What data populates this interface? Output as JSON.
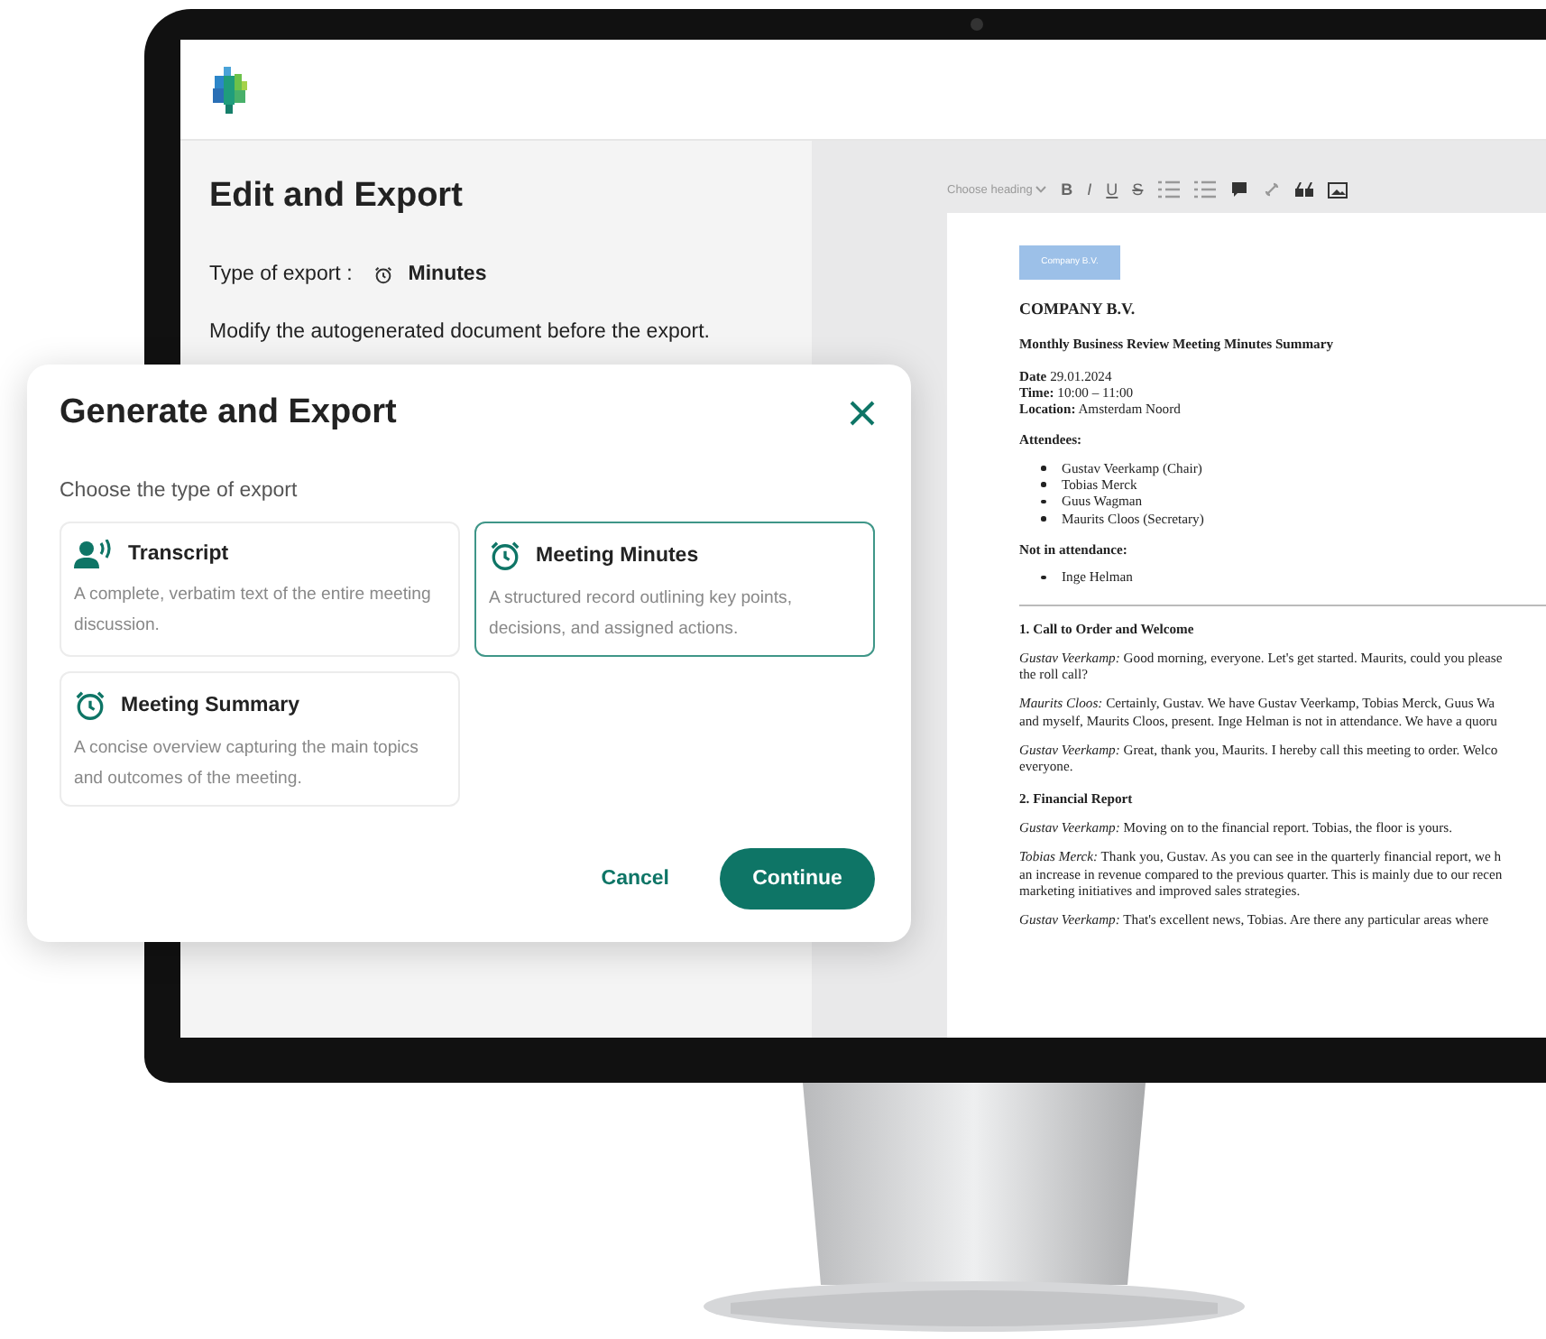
{
  "left_panel": {
    "title": "Edit and Export",
    "export_type_label": "Type of export :",
    "export_type_value": "Minutes",
    "hint": "Modify the autogenerated document before the export."
  },
  "editor": {
    "toolbar": {
      "heading_select": "Choose heading",
      "format_buttons": [
        "B",
        "I",
        "U",
        "S"
      ]
    },
    "document": {
      "logo_text": "Company B.V.",
      "company": "COMPANY B.V.",
      "title": "Monthly Business Review Meeting Minutes Summary",
      "details": [
        "**Date** 29.01.2024",
        "**Time:** 10:00 – 11:00",
        "**Location:** Amsterdam Noord"
      ],
      "attendees_heading": "Attendees:",
      "attendees": [
        "Gustav Veerkamp (Chair)",
        "Tobias Merck",
        "Guus Wagman",
        "Maurits Cloos (Secretary)"
      ],
      "absent_heading": "Not in attendance:",
      "absent": [
        "Inge Helman"
      ],
      "sections": [
        {
          "heading": "1. Call to Order and Welcome",
          "paragraphs": [
            [
              "*Gustav Veerkamp:* Good morning, everyone. Let's get started. Maurits, could you please",
              "the roll call?"
            ],
            [
              "*Maurits Cloos:* Certainly, Gustav. We have Gustav Veerkamp, Tobias Merck, Guus Wa",
              "and myself, Maurits Cloos, present. Inge Helman is not in attendance. We have a quoru"
            ],
            [
              "*Gustav Veerkamp:* Great, thank you, Maurits. I hereby call this meeting to order. Welco",
              "everyone."
            ]
          ]
        },
        {
          "heading": "2. Financial Report",
          "paragraphs": [
            [
              "*Gustav Veerkamp:* Moving on to the financial report. Tobias, the floor is yours."
            ],
            [
              "*Tobias Merck:* Thank you, Gustav. As you can see in the quarterly financial report, we h",
              "an increase in revenue compared to the previous quarter. This is mainly due to our recen",
              "marketing initiatives and improved sales strategies."
            ],
            [
              "*Gustav Veerkamp:* That's excellent news, Tobias. Are there any particular areas where"
            ]
          ]
        }
      ]
    }
  },
  "dialog": {
    "title": "Generate and Export",
    "subtitle": "Choose the type of export",
    "options": [
      {
        "kind": "transcript",
        "title": "Transcript",
        "description": "A complete, verbatim text of the entire meeting discussion.",
        "selected": false
      },
      {
        "kind": "clock",
        "title": "Meeting Minutes",
        "description": "A structured record outlining key points, decisions, and assigned actions.",
        "selected": true
      },
      {
        "kind": "clock",
        "title": "Meeting Summary",
        "description": "A concise overview capturing the main topics and outcomes of the meeting.",
        "selected": false
      }
    ],
    "buttons": {
      "cancel": "Cancel",
      "continue": "Continue"
    }
  }
}
